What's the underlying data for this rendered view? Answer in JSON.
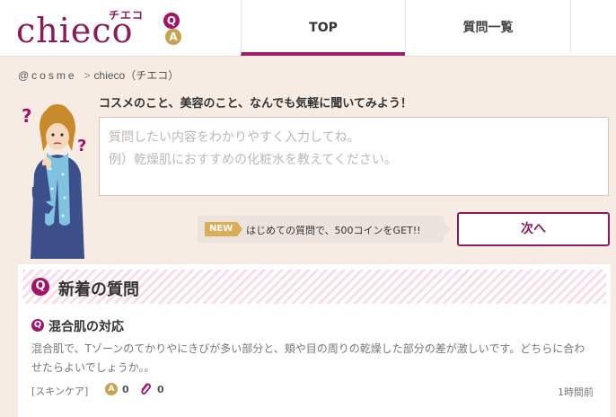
{
  "logo": {
    "word": "chieco",
    "kana": "チエコ",
    "q": "Q",
    "a": "A"
  },
  "nav": {
    "tabs": [
      {
        "label": "TOP",
        "active": true
      },
      {
        "label": "質問一覧",
        "active": false
      }
    ]
  },
  "breadcrumb": {
    "site": "@cosme",
    "separator": ">",
    "current": "chieco（チエコ）"
  },
  "ask": {
    "prompt": "コスメのこと、美容のこと、なんでも気軽に聞いてみよう！",
    "placeholder": "質問したい内容をわかりやすく入力してね。\n例）乾燥肌におすすめの化粧水を教えてください。",
    "value": "",
    "bonus_badge": "NEW",
    "bonus_text": "はじめての質問で、500コインをGET!!",
    "next_label": "次へ"
  },
  "new_questions": {
    "badge": "Q",
    "title": "新着の質問",
    "items": [
      {
        "badge": "Q",
        "title": "混合肌の対応",
        "body": "混合肌で、Tゾーンのてかりやにきびが多い部分と、頬や目の周りの乾燥した部分の差が激しいです。どちらに合わせたらよいでしょうか。。",
        "category": "[スキンケア]",
        "answer_badge": "A",
        "answers": "0",
        "clips": "0",
        "time": "1時間前"
      }
    ]
  },
  "colors": {
    "brand": "#8d1a5b",
    "q_badge": "#a3136a",
    "a_badge": "#c8a24f",
    "new_badge": "#d8ac58",
    "background": "#f6ece4"
  }
}
